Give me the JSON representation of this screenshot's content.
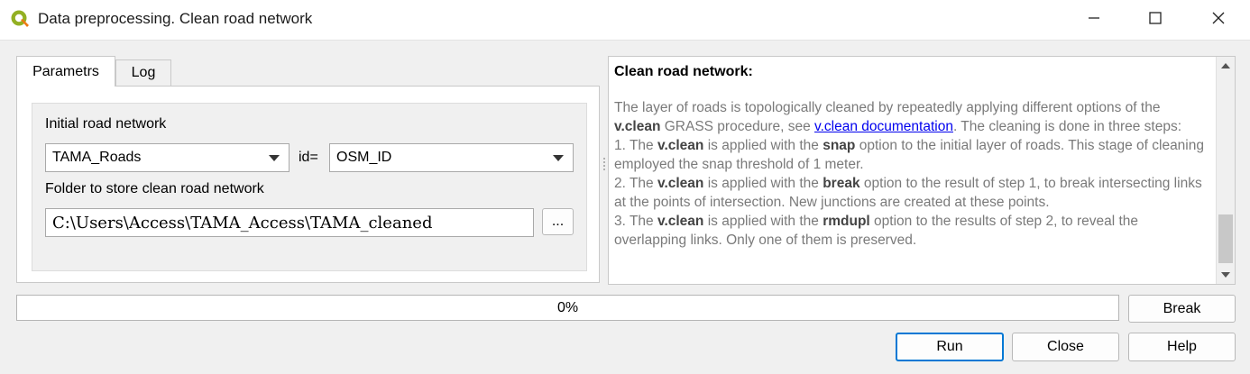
{
  "window": {
    "title": "Data preprocessing. Clean road network",
    "icon": "qgis-logo-icon",
    "controls": [
      "minimize-icon",
      "maximize-icon",
      "close-icon"
    ]
  },
  "tabs": [
    {
      "label": "Parametrs",
      "active": true
    },
    {
      "label": "Log",
      "active": false
    }
  ],
  "params": {
    "road_network_label": "Initial road network",
    "road_layer_value": "TAMA_Roads",
    "id_label": "id=",
    "id_field_value": "OSM_ID",
    "folder_label": "Folder to store clean road network",
    "folder_value": "C:\\Users\\Access\\TAMA_Access\\TAMA_cleaned",
    "browse_label": "..."
  },
  "help": {
    "title": "Clean road network:",
    "p1_a": "The layer of roads is topologically cleaned by repeatedly applying different options of the ",
    "p1_b": "v.clean",
    "p1_c": " GRASS procedure, see ",
    "p1_link": "v.clean documentation",
    "p1_d": ". The cleaning is done in three steps:",
    "s1_a": "1. The ",
    "s1_b": "v.clean",
    "s1_c": " is applied with the ",
    "s1_d": "snap",
    "s1_e": " option to the initial layer of roads. This stage of cleaning employed the snap threshold of 1 meter.",
    "s2_a": "2. The ",
    "s2_b": "v.clean",
    "s2_c": " is applied with the ",
    "s2_d": "break",
    "s2_e": " option to the result of step 1, to break intersecting links at the points of intersection. New junctions are created at these points.",
    "s3_a": "3. The ",
    "s3_b": "v.clean",
    "s3_c": " is applied with the ",
    "s3_d": "rmdupl",
    "s3_e": " option to the results of step 2, to reveal the overlapping links. Only one of them is preserved."
  },
  "progress": {
    "value": 0,
    "text": "0%"
  },
  "buttons": {
    "break": "Break",
    "run": "Run",
    "close": "Close",
    "help": "Help"
  },
  "colors": {
    "accent": "#0078d4",
    "link": "#0000ee",
    "progress": "#06b025"
  }
}
